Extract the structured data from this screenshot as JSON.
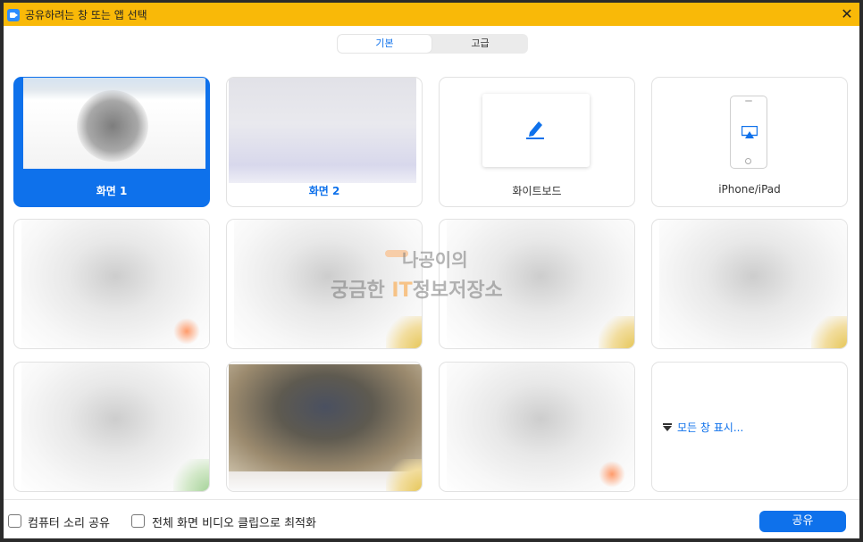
{
  "window": {
    "title": "공유하려는 창 또는 앱 선택"
  },
  "tabs": [
    {
      "label": "기본",
      "active": true
    },
    {
      "label": "고급",
      "active": false
    }
  ],
  "tiles": {
    "screen1": "화면 1",
    "screen2": "화면 2",
    "whiteboard": "화이트보드",
    "iphone": "iPhone/iPad",
    "show_all": "모든 창 표시..."
  },
  "watermark": {
    "line1": "나공이의",
    "line2_a": "궁금한 ",
    "line2_it": "IT",
    "line2_b": "정보저장소"
  },
  "bottom": {
    "computer_sound": "컴퓨터 소리 공유",
    "optimize_video": "전체 화면 비디오 클립으로 최적화",
    "share_button": "공유"
  },
  "colors": {
    "accent": "#0e71eb",
    "titlebar": "#f9b908"
  }
}
